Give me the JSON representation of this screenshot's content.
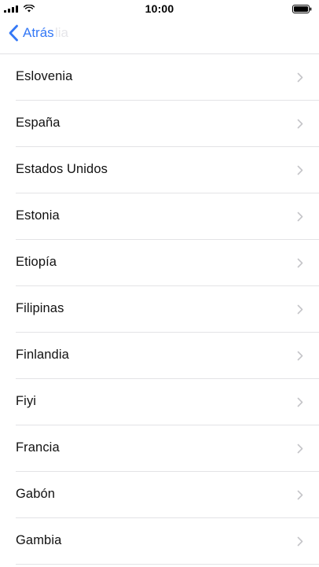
{
  "status_bar": {
    "time": "10:00",
    "icons": [
      "signal-icon",
      "wifi-icon",
      "battery-icon"
    ]
  },
  "nav": {
    "back_label": "Atrás",
    "back_icon": "chevron-left-icon",
    "faded_title": "lia"
  },
  "countries": [
    "Eslovenia",
    "España",
    "Estados Unidos",
    "Estonia",
    "Etiopía",
    "Filipinas",
    "Finlandia",
    "Fiyi",
    "Francia",
    "Gabón",
    "Gambia"
  ],
  "colors": {
    "accent": "#3478f6",
    "separator": "#e3e3e6",
    "chevron": "#c4c4c8"
  }
}
